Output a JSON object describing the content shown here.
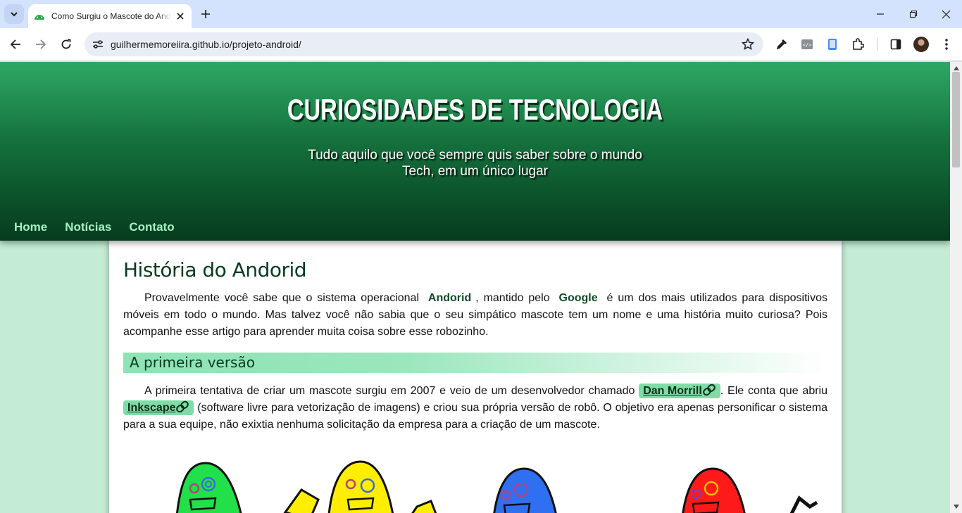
{
  "browser": {
    "tab_title": "Como Surgiu o Mascote do Android",
    "url": "guilhermemoreiira.github.io/projeto-android/"
  },
  "site": {
    "title": "CURIOSIDADES DE TECNOLOGIA",
    "subtitle_line1": "Tudo aquilo que você sempre quis saber sobre o mundo",
    "subtitle_line2": "Tech, em um único lugar",
    "menu": [
      "Home",
      "Notícias",
      "Contato"
    ]
  },
  "article": {
    "title": "História do Andorid",
    "intro": {
      "part1": "Provavelmente você sabe que o sistema operacional ",
      "kw1": "Andorid",
      "part2": ", mantido pelo ",
      "kw2": "Google",
      "part3": " é um dos mais utilizados para dispositivos móveis em todo o mundo. Mas talvez você não sabia que o seu simpático mascote tem um nome e uma história muito curiosa? Pois acompanhe esse artigo para aprender muita coisa sobre esse robozinho."
    },
    "section1_title": "A primeira versão",
    "section1": {
      "part1": "A primeira tentativa de criar um mascote surgiu em 2007 e veio de um desenvolvedor chamado ",
      "link1": "Dan Morrill",
      "part2": ". Ele conta que abriu ",
      "link2": "Inkscape",
      "part3": " (software livre para vetorização de imagens) e criou sua própria versão de robô. O objetivo era apenas personificar o sistema para a sua equipe, não exixtia nenhuma solicitação da empresa para a criação de um mascote."
    }
  },
  "colors": {
    "header_top": "#2ea864",
    "header_bottom": "#063b1e",
    "page_bg": "#c4ebd4",
    "menu_link": "#a7f0c2",
    "chip_bg": "#7fdca6"
  }
}
